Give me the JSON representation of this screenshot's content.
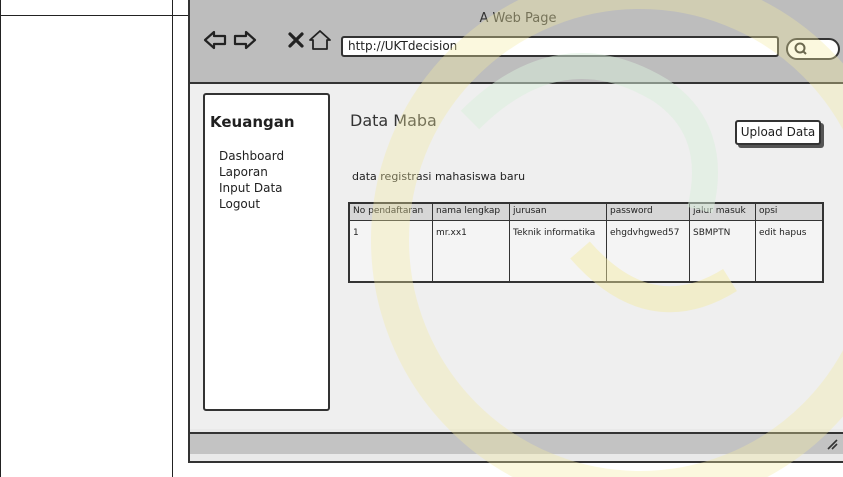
{
  "browser": {
    "title": "A Web Page",
    "url": "http://UKTdecision",
    "icons": [
      "back-arrow-icon",
      "forward-arrow-icon",
      "close-x-icon",
      "home-icon",
      "search-icon",
      "resize-grip-icon"
    ]
  },
  "sidebar": {
    "title": "Keuangan",
    "items": [
      {
        "label": "Dashboard"
      },
      {
        "label": "Laporan"
      },
      {
        "label": "Input Data"
      },
      {
        "label": "Logout"
      }
    ]
  },
  "main": {
    "title": "Data Maba",
    "upload_label": "Upload Data",
    "description": "data registrasi mahasiswa baru",
    "table": {
      "headers": [
        "No pendaftaran",
        "nama lengkap",
        "jurusan",
        "password",
        "jalur masuk",
        "opsi"
      ],
      "rows": [
        [
          "1",
          "mr.xx1",
          "Teknik informatika",
          "ehgdvhgwed57",
          "SBMPTN",
          "edit hapus"
        ]
      ]
    }
  }
}
